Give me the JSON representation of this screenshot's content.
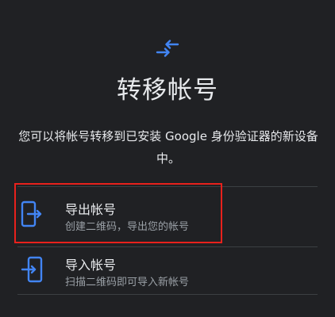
{
  "header": {
    "icon": "transfer-arrows-icon",
    "title": "转移帐号"
  },
  "description": "您可以将帐号转移到已安装 Google 身份验证器的新设备中。",
  "options": [
    {
      "icon": "phone-export-icon",
      "title": "导出帐号",
      "subtitle": "创建二维码，导出您的帐号"
    },
    {
      "icon": "phone-import-icon",
      "title": "导入帐号",
      "subtitle": "扫描二维码即可导入新帐号"
    }
  ],
  "colors": {
    "background": "#202124",
    "accent": "#4285f4",
    "text_primary": "#e8eaed",
    "text_secondary": "#9aa0a6",
    "highlight": "#e8211c"
  }
}
